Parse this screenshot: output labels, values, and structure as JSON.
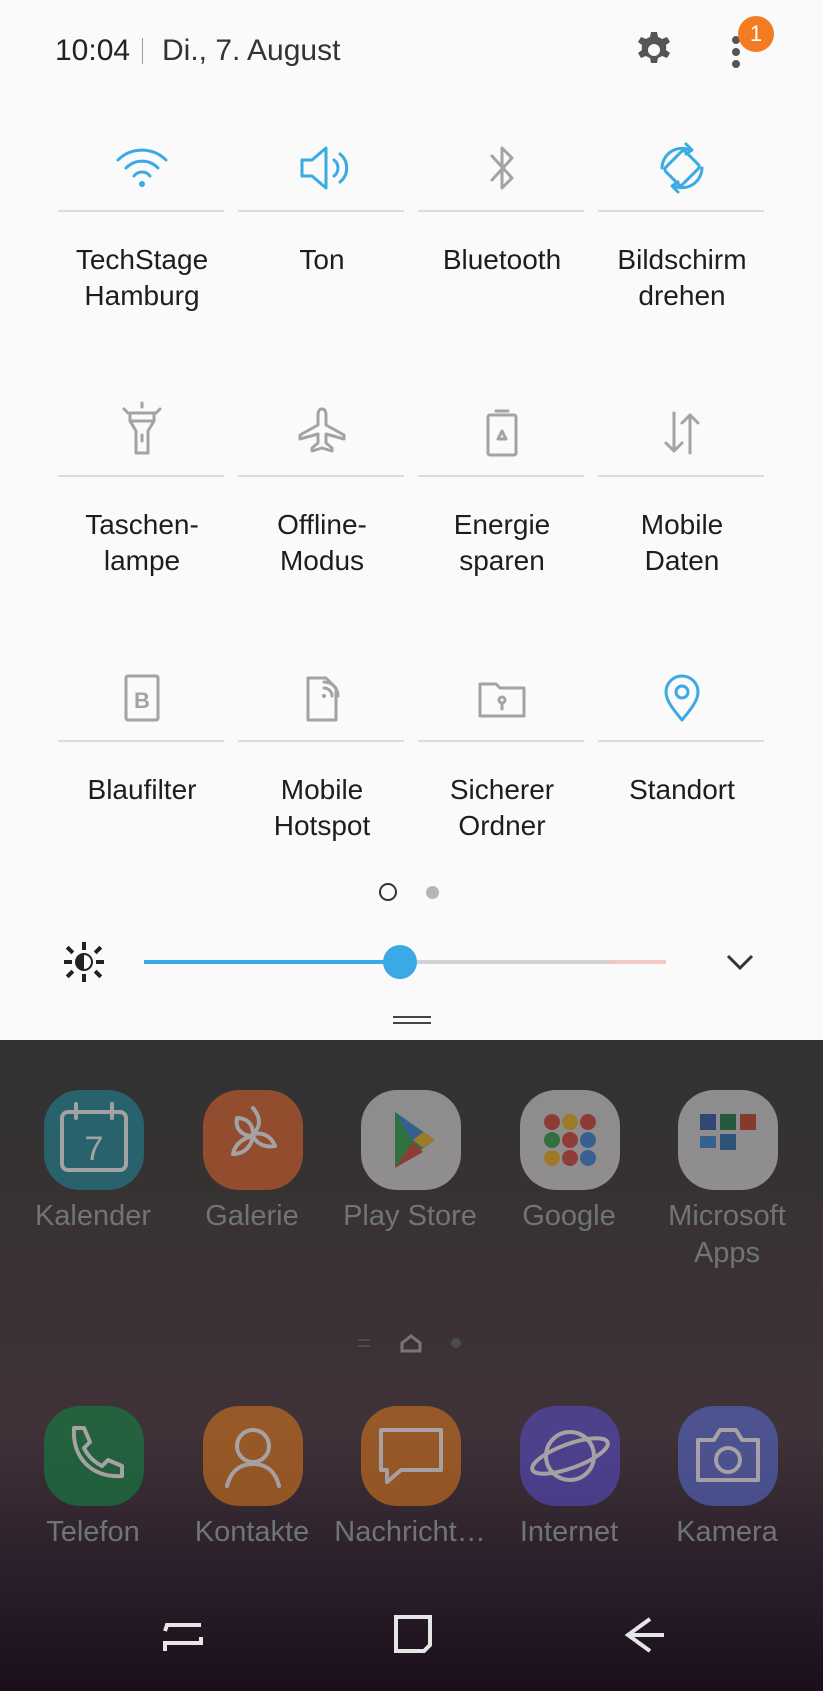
{
  "status_bar": {
    "time": "10:04",
    "date": "Di., 7. August",
    "notification_count": "1"
  },
  "quick_tiles": [
    {
      "label": "TechStage\nHamburg",
      "icon": "wifi-icon",
      "active": true
    },
    {
      "label": "Ton",
      "icon": "speaker-icon",
      "active": true
    },
    {
      "label": "Bluetooth",
      "icon": "bluetooth-icon",
      "active": false
    },
    {
      "label": "Bildschirm\ndrehen",
      "icon": "rotate-icon",
      "active": true
    },
    {
      "label": "Taschen-\nlampe",
      "icon": "flashlight-icon",
      "active": false
    },
    {
      "label": "Offline-\nModus",
      "icon": "airplane-icon",
      "active": false
    },
    {
      "label": "Energie\nsparen",
      "icon": "battery-saver-icon",
      "active": false
    },
    {
      "label": "Mobile\nDaten",
      "icon": "mobile-data-icon",
      "active": false
    },
    {
      "label": "Blaufilter",
      "icon": "blue-filter-icon",
      "active": false
    },
    {
      "label": "Mobile\nHotspot",
      "icon": "hotspot-icon",
      "active": false
    },
    {
      "label": "Sicherer\nOrdner",
      "icon": "secure-folder-icon",
      "active": false
    },
    {
      "label": "Standort",
      "icon": "location-icon",
      "active": true
    }
  ],
  "brightness": {
    "level": 0.49
  },
  "home_apps": [
    {
      "label": "Kalender",
      "color": "#1f8a9e",
      "icon": "calendar-icon"
    },
    {
      "label": "Galerie",
      "color": "#e0622b",
      "icon": "gallery-icon"
    },
    {
      "label": "Play Store",
      "color": "#d9d9d9",
      "icon": "play-store-icon"
    },
    {
      "label": "Google",
      "color": "#d9d9d9",
      "icon": "google-folder-icon"
    },
    {
      "label": "Microsoft\nApps",
      "color": "#d9d9d9",
      "icon": "microsoft-folder-icon"
    }
  ],
  "dock_apps": [
    {
      "label": "Telefon",
      "color": "#0f8a45",
      "icon": "phone-icon"
    },
    {
      "label": "Kontakte",
      "color": "#e07a1a",
      "icon": "contacts-icon"
    },
    {
      "label": "Nachricht…",
      "color": "#e07a1a",
      "icon": "messages-icon"
    },
    {
      "label": "Internet",
      "color": "#5b4fd1",
      "icon": "internet-icon"
    },
    {
      "label": "Kamera",
      "color": "#5a6fd6",
      "icon": "camera-icon"
    }
  ],
  "colors": {
    "accent": "#3aa9e4",
    "inactive_icon": "#a3a3a3",
    "badge": "#f47b20"
  }
}
